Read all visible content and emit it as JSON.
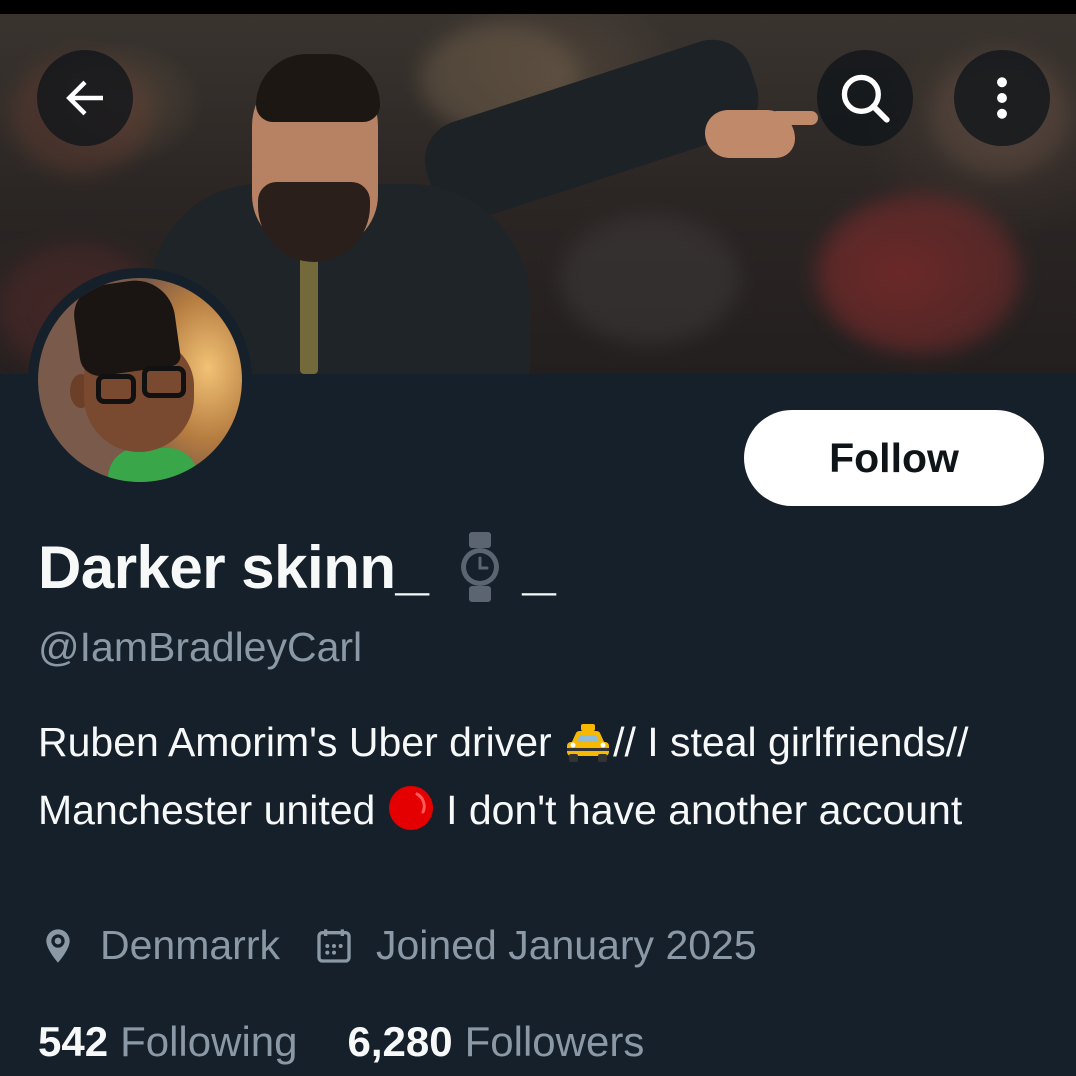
{
  "header": {
    "back_icon": "arrow-left-icon",
    "search_icon": "search-icon",
    "more_icon": "more-vertical-icon"
  },
  "profile": {
    "display_name": "Darker skinn_",
    "display_name_suffix": "_",
    "display_name_icon": "watch-icon",
    "handle": "@IamBradleyCarl",
    "follow_label": "Follow",
    "bio": {
      "part1": "Ruben Amorim's Uber driver ",
      "part2": "// I steal girlfriends// Manchester united ",
      "part3": " I don't have another account",
      "emoji1": "taxi-icon",
      "emoji2": "red-circle-icon"
    },
    "location": "Denmarrk",
    "joined": "Joined January 2025",
    "following_count": "542",
    "following_label": "Following",
    "followers_count": "6,280",
    "followers_label": "Followers"
  },
  "colors": {
    "background": "#15202b",
    "primary_text": "#f7f9f9",
    "secondary_text": "#8b98a5",
    "follow_bg": "#ffffff"
  }
}
